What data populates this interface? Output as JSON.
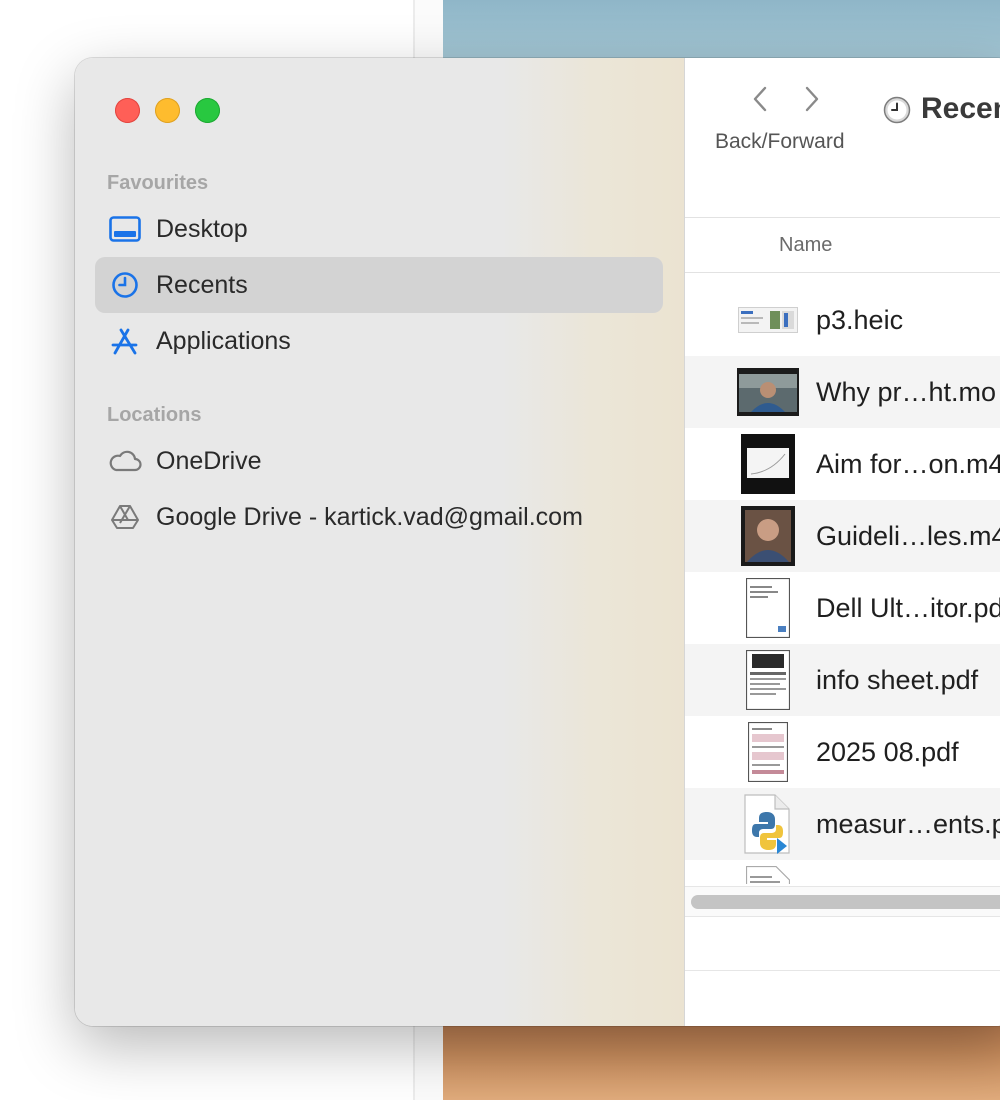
{
  "sidebar": {
    "favourites_title": "Favourites",
    "favourites": [
      {
        "label": "Desktop",
        "icon": "desktop-icon",
        "selected": false
      },
      {
        "label": "Recents",
        "icon": "clock-icon",
        "selected": true
      },
      {
        "label": "Applications",
        "icon": "applications-icon",
        "selected": false
      }
    ],
    "locations_title": "Locations",
    "locations": [
      {
        "label": "OneDrive",
        "icon": "cloud-icon"
      },
      {
        "label": "Google Drive - kartick.vad@gmail.com",
        "icon": "google-drive-icon"
      }
    ]
  },
  "toolbar": {
    "nav_label": "Back/Forward",
    "title": "Recen",
    "title_icon": "clock-icon"
  },
  "list": {
    "column_name": "Name",
    "files": [
      {
        "name": "p3.heic",
        "thumb": "screenshot-thumbnail"
      },
      {
        "name": "Why pr…ht.mo",
        "thumb": "video-thumbnail"
      },
      {
        "name": "Aim for…on.m4",
        "thumb": "video-thumbnail"
      },
      {
        "name": "Guideli…les.m4",
        "thumb": "video-thumbnail"
      },
      {
        "name": "Dell Ult…itor.pd",
        "thumb": "pdf-thumbnail"
      },
      {
        "name": "info sheet.pdf",
        "thumb": "pdf-thumbnail"
      },
      {
        "name": "2025 08.pdf",
        "thumb": "pdf-thumbnail"
      },
      {
        "name": "measur…ents.p",
        "thumb": "python-file-icon"
      },
      {
        "name": "",
        "thumb": "pdf-thumbnail"
      }
    ]
  },
  "colors": {
    "accent": "#1a73e8",
    "close": "#ff5f57",
    "minimize": "#febc2e",
    "maximize": "#28c840"
  }
}
